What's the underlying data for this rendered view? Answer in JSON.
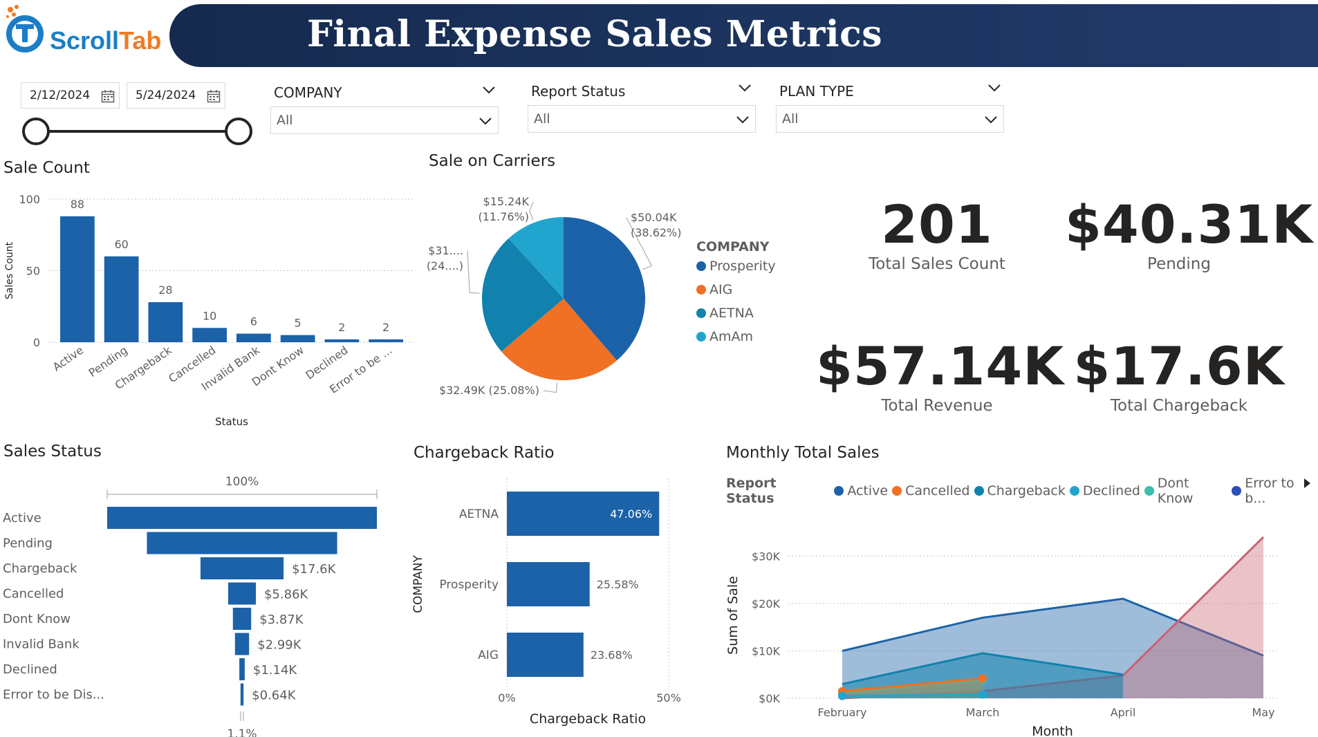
{
  "header": {
    "brand_first": "Scroll",
    "brand_second": "Tab",
    "title": "Final Expense Sales Metrics"
  },
  "filters": {
    "date_start": "2/12/2024",
    "date_end": "5/24/2024",
    "company": {
      "title": "COMPANY",
      "value": "All"
    },
    "report_status": {
      "title": "Report Status",
      "value": "All"
    },
    "plan_type": {
      "title": "PLAN TYPE",
      "value": "All"
    }
  },
  "kpis": {
    "total_sales_count": {
      "value": "201",
      "label": "Total Sales Count"
    },
    "pending": {
      "value": "$40.31K",
      "label": "Pending"
    },
    "total_revenue": {
      "value": "$57.14K",
      "label": "Total Revenue"
    },
    "total_chargeback": {
      "value": "$17.6K",
      "label": "Total Chargeback"
    }
  },
  "legend_company": {
    "title": "COMPANY",
    "items": [
      "Prosperity",
      "AIG",
      "AETNA",
      "AmAm"
    ]
  },
  "legend_status": {
    "title": "Report Status",
    "items": [
      "Active",
      "Cancelled",
      "Chargeback",
      "Declined",
      "Dont Know",
      "Error to b..."
    ]
  },
  "colors": {
    "primary": "#1b62a8",
    "orange": "#f07024",
    "teal": "#1082ad",
    "light_teal": "#21a5cf",
    "mint": "#3bbfad",
    "navy_band": "#1d3561",
    "rose": "#c9626f"
  },
  "chart_data": [
    {
      "type": "bar",
      "title": "Sale Count",
      "xlabel": "Status",
      "ylabel": "Sales Count",
      "ylim": [
        0,
        100
      ],
      "yticks": [
        "0",
        "50",
        "100"
      ],
      "categories": [
        "Active",
        "Pending",
        "Chargeback",
        "Cancelled",
        "Invalid Bank",
        "Dont Know",
        "Declined",
        "Error to be ..."
      ],
      "values": [
        88,
        60,
        28,
        10,
        6,
        5,
        2,
        2
      ],
      "grid": true
    },
    {
      "type": "pie",
      "title": "Sale on Carriers",
      "legend": "right",
      "slices": [
        {
          "name": "Prosperity",
          "value": 50.04,
          "label": "$50.04K",
          "pct": "(38.62%)"
        },
        {
          "name": "AIG",
          "value": 32.49,
          "label": "$32.49K (25.08%)",
          "pct": ""
        },
        {
          "name": "AETNA",
          "value": 31.6,
          "label": "$31....",
          "pct": "(24....)"
        },
        {
          "name": "AmAm",
          "value": 15.24,
          "label": "$15.24K",
          "pct": "(11.76%)"
        }
      ]
    },
    {
      "type": "bar",
      "orientation": "funnel",
      "title": "Sales Status",
      "top_label": "100%",
      "bottom_label": "1.1%",
      "categories": [
        "Active",
        "Pending",
        "Chargeback",
        "Cancelled",
        "Dont Know",
        "Invalid Bank",
        "Declined",
        "Error to be Dis..."
      ],
      "values": [
        57.14,
        40.31,
        17.6,
        5.86,
        3.87,
        2.99,
        1.14,
        0.64
      ],
      "data_labels": [
        "",
        "",
        "$17.6K",
        "$5.86K",
        "$3.87K",
        "$2.99K",
        "$1.14K",
        "$0.64K"
      ]
    },
    {
      "type": "bar",
      "orientation": "horizontal",
      "title": "Chargeback Ratio",
      "xlabel": "Chargeback Ratio",
      "ylabel": "COMPANY",
      "xlim": [
        0,
        50
      ],
      "xticks": [
        "0%",
        "50%"
      ],
      "categories": [
        "AETNA",
        "Prosperity",
        "AIG"
      ],
      "values": [
        47.06,
        25.58,
        23.68
      ],
      "data_labels": [
        "47.06%",
        "25.58%",
        "23.68%"
      ]
    },
    {
      "type": "area",
      "title": "Monthly Total Sales",
      "xlabel": "Month",
      "ylabel": "Sum of Sale",
      "categories": [
        "February",
        "March",
        "April",
        "May"
      ],
      "ylim": [
        0,
        35000
      ],
      "yticks": [
        "$0K",
        "$10K",
        "$20K",
        "$30K"
      ],
      "legend": "top",
      "series": [
        {
          "name": "Active",
          "values": [
            10000,
            17000,
            21000,
            9000
          ]
        },
        {
          "name": "Cancelled",
          "values": [
            1500,
            4200,
            null,
            null
          ]
        },
        {
          "name": "Chargeback",
          "values": [
            3000,
            9500,
            5000,
            null
          ]
        },
        {
          "name": "Declined",
          "values": [
            500,
            800,
            null,
            null
          ]
        },
        {
          "name": "Dont Know",
          "values": [
            1000,
            3800,
            null,
            null
          ]
        },
        {
          "name": "Error to b...",
          "values": [
            0,
            1500,
            4800,
            34000
          ]
        }
      ]
    }
  ]
}
